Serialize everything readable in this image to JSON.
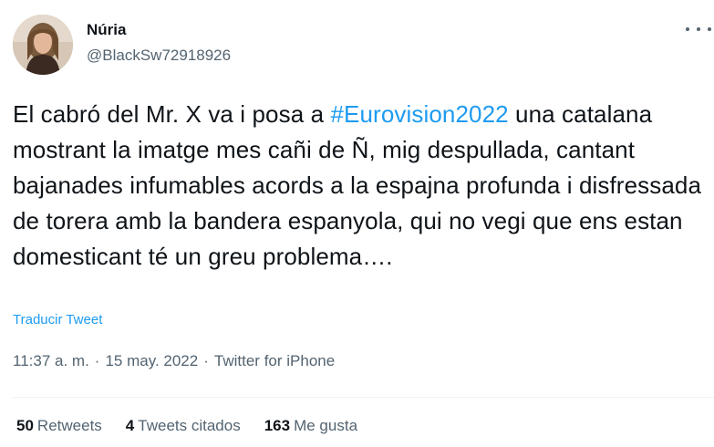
{
  "author": {
    "display_name": "Núria",
    "handle": "@BlackSw72918926",
    "avatar_icon": "profile-photo"
  },
  "tweet": {
    "text_before": "El cabró del Mr. X va i posa a ",
    "hashtag": "#Eurovision2022",
    "text_after": " una catalana mostrant la imatge mes cañi de Ñ, mig despullada, cantant bajanades infumables acords a la espajna profunda i disfressada de torera amb la bandera espanyola, qui no vegi que ens estan domesticant té un greu problema….",
    "translate_label": "Traducir Tweet"
  },
  "meta": {
    "time": "11:37 a. m.",
    "separator": "·",
    "date": "15 may. 2022",
    "source": "Twitter for iPhone"
  },
  "stats": {
    "retweets_count": "50",
    "retweets_label": "Retweets",
    "quotes_count": "4",
    "quotes_label": "Tweets citados",
    "likes_count": "163",
    "likes_label": "Me gusta"
  },
  "colors": {
    "link": "#1d9bf0",
    "text_primary": "#0f1419",
    "text_secondary": "#536471",
    "divider": "#eff3f4"
  }
}
